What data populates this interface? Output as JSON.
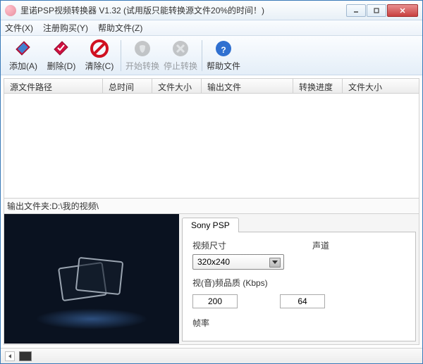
{
  "title": "里诺PSP视频转换器 V1.32 (试用版只能转换源文件20%的时间！)",
  "menu": {
    "file": "文件(X)",
    "register": "注册购买(Y)",
    "help": "帮助文件(Z)"
  },
  "toolbar": {
    "add": "添加(A)",
    "delete": "删除(D)",
    "clear": "清除(C)",
    "start": "开始转换",
    "stop": "停止转换",
    "help": "帮助文件"
  },
  "columns": {
    "srcpath": "源文件路径",
    "totaltime": "总时间",
    "filesize": "文件大小",
    "output": "输出文件",
    "progress": "转换进度",
    "outsize": "文件大小"
  },
  "output": {
    "label": "输出文件夹: ",
    "value": "D:\\我的视频\\"
  },
  "settings": {
    "tab": "Sony PSP",
    "videosize_label": "视频尺寸",
    "videosize_value": "320x240",
    "channel_label": "声道",
    "bitrate_label": "视(音)频品质 (Kbps)",
    "vbitrate": "200",
    "abitrate": "64",
    "framerate_label": "帧率"
  }
}
